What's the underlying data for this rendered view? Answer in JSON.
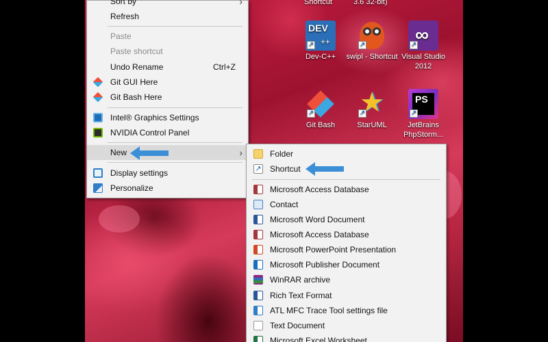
{
  "desktop": {
    "top_labels": [
      "Shortcut",
      "3.6 32-bit)"
    ],
    "icons": [
      {
        "label": "Dev-C++",
        "badge": "DEV",
        "color": "#2a6fb8"
      },
      {
        "label": "swipl - Shortcut",
        "badge": "",
        "color": "#e2571d"
      },
      {
        "label": "Visual Studio 2012",
        "badge": "",
        "color": "#6a2c91"
      },
      {
        "label": "Git Bash",
        "badge": "",
        "color": "#f0503a"
      },
      {
        "label": "StarUML",
        "badge": "",
        "color": "#f3c12a"
      },
      {
        "label": "JetBrains PhpStorm...",
        "badge": "PS",
        "color": "#b63cd6"
      }
    ]
  },
  "context_menu": {
    "items": [
      {
        "label": "Sort by",
        "arrow": "›"
      },
      {
        "label": "Refresh"
      },
      {
        "label": "Paste"
      },
      {
        "label": "Paste shortcut"
      },
      {
        "label": "Undo Rename",
        "shortcut": "Ctrl+Z"
      },
      {
        "label": "Git GUI Here"
      },
      {
        "label": "Git Bash Here"
      },
      {
        "label": "Intel® Graphics Settings"
      },
      {
        "label": "NVIDIA Control Panel"
      },
      {
        "label": "New",
        "arrow": "›"
      },
      {
        "label": "Display settings"
      },
      {
        "label": "Personalize"
      }
    ]
  },
  "new_submenu": {
    "items": [
      {
        "label": "Folder"
      },
      {
        "label": "Shortcut"
      },
      {
        "label": "Microsoft Access Database"
      },
      {
        "label": "Contact"
      },
      {
        "label": "Microsoft Word Document"
      },
      {
        "label": "Microsoft Access Database"
      },
      {
        "label": "Microsoft PowerPoint Presentation"
      },
      {
        "label": "Microsoft Publisher Document"
      },
      {
        "label": "WinRAR archive"
      },
      {
        "label": "Rich Text Format"
      },
      {
        "label": "ATL MFC Trace Tool settings file"
      },
      {
        "label": "Text Document"
      },
      {
        "label": "Microsoft Excel Worksheet"
      }
    ]
  },
  "colors": {
    "arrow_blue": "#3b8fd6",
    "menu_bg": "#f2f2f2",
    "highlight": "#dadada"
  }
}
